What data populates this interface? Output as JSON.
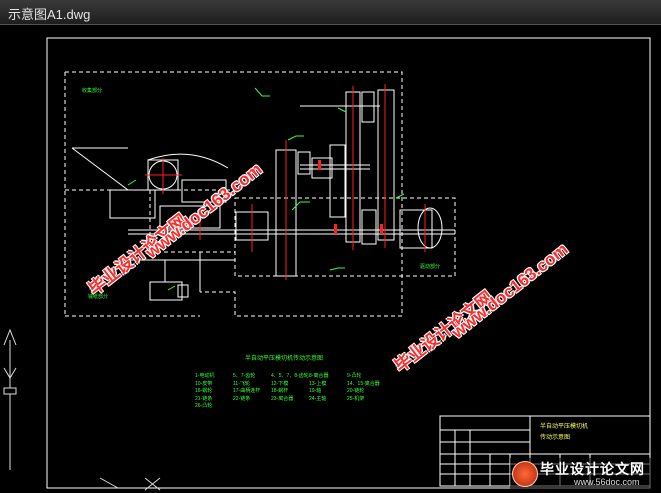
{
  "window": {
    "title": "示意图A1.dwg"
  },
  "drawing": {
    "main_caption": "半自动平压模切机传动示意图",
    "title_block_name": "半自动平压模切机\n传动示意图",
    "legend": [
      "1-电动机",
      "5、7-齿轮",
      "4、5、7、8-齿轮",
      "8-离合器",
      "9-凸轮",
      "10-皮带",
      "11-飞轮",
      "12-下模",
      "13-上模",
      "14、15-离合器",
      "16-蜗轮",
      "17-曲柄连杆",
      "18-蜗杆",
      "19-轴",
      "20-链轮",
      "21-链条",
      "22-链条",
      "23-离合器",
      "24-主轴",
      "25-机架",
      "26-凸轮"
    ]
  },
  "watermarks": {
    "line1": "毕业设计论文网",
    "line2": "www.doc163.com"
  },
  "logo": {
    "text": "毕业设计论文网",
    "url": "www.56doc.com"
  }
}
